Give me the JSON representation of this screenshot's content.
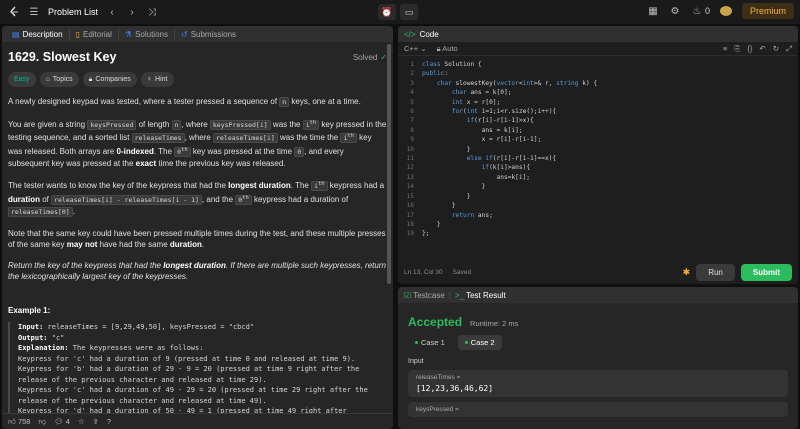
{
  "topbar": {
    "problem_list": "Problem List",
    "coins": "0",
    "premium": "Premium"
  },
  "left": {
    "tabs": [
      "Description",
      "Editorial",
      "Solutions",
      "Submissions"
    ],
    "title": "1629. Slowest Key",
    "solved": "Solved",
    "chips": [
      "Easy",
      "Topics",
      "Companies",
      "Hint"
    ],
    "p1": {
      "a": "A newly designed keypad was tested, where a tester pressed a sequence of ",
      "code": "n",
      "b": " keys, one at a time."
    },
    "p2": {
      "a": "You are given a string ",
      "c1": "keysPressed",
      "b": " of length ",
      "c2": "n",
      "c": ", where ",
      "c3": "keysPressed[i]",
      "d": " was the ",
      "ith": "i",
      "th": "th",
      "e": " key pressed in the testing sequence, and a sorted list ",
      "c4": "releaseTimes",
      "f": ", where ",
      "c5": "releaseTimes[i]",
      "g": " was the time the ",
      "h": " key was released. Both arrays are ",
      "bold1": "0-indexed",
      "i": ". The ",
      "zero": "0",
      "j": " key was pressed at the time ",
      "c6": "0",
      "k": ", and every subsequent key was pressed at the ",
      "bold2": "exact",
      "l": " time the previous key was released."
    },
    "p3": {
      "a": "The tester wants to know the key of the keypress that had the ",
      "bold1": "longest duration",
      "b": ". The ",
      "c": " keypress had a ",
      "bold2": "duration",
      "d": " of ",
      "c1": "releaseTimes[i] - releaseTimes[i - 1]",
      "e": ", and the ",
      "f": " keypress had a duration of ",
      "c2": "releaseTimes[0]",
      "g": "."
    },
    "p4": {
      "a": "Note that the same key could have been pressed multiple times during the test, and these multiple presses of the same key ",
      "bold1": "may not",
      "b": " have had the same ",
      "bold2": "duration",
      "c": "."
    },
    "p5": {
      "a": "Return the key of the keypress that had the ",
      "bold1": "longest duration",
      "b": ". If there are multiple such keypresses, return the lexicographically largest key of the keypresses."
    },
    "example_title": "Example 1:",
    "example": [
      {
        "label": "Input:",
        "text": " releaseTimes = [9,29,49,50], keysPressed = \"cbcd\""
      },
      {
        "label": "Output:",
        "text": " \"c\""
      },
      {
        "label": "Explanation:",
        "text": " The keypresses were as follows:"
      },
      {
        "label": "",
        "text": "Keypress for 'c' had a duration of 9 (pressed at time 0 and released at time 9)."
      },
      {
        "label": "",
        "text": "Keypress for 'b' had a duration of 29 - 9 = 20 (pressed at time 9 right after the release of the previous character and released at time 29)."
      },
      {
        "label": "",
        "text": "Keypress for 'c' had a duration of 49 - 29 = 20 (pressed at time 29 right after the release of the previous character and released at time 49)."
      },
      {
        "label": "",
        "text": "Keypress for 'd' had a duration of 50 - 49 = 1 (pressed at time 49 right after"
      }
    ],
    "likes": "758",
    "comments": "4"
  },
  "code": {
    "header": "Code",
    "lang": "C++",
    "auto": "Auto",
    "lines": [
      "class Solution {",
      "public:",
      "    char slowestKey(vector<int>& r, string k) {",
      "        char ans = k[0];",
      "        int x = r[0];",
      "        for(int i=1;i<r.size();i++){",
      "            if(r[i]-r[i-1]>x){",
      "                ans = k[i];",
      "                x = r[i]-r[i-1];",
      "            }",
      "            else if(r[i]-r[i-1]==x){",
      "                if(k[i]>ans){",
      "                    ans=k[i];",
      "                }",
      "            }",
      "        }",
      "        return ans;",
      "    }",
      "};"
    ],
    "status": "Ln 13, Col 30",
    "saved": "Saved",
    "run": "Run",
    "submit": "Submit"
  },
  "result": {
    "tabs": [
      "Testcase",
      "Test Result"
    ],
    "accepted": "Accepted",
    "runtime": "Runtime: 2 ms",
    "cases": [
      "Case 1",
      "Case 2"
    ],
    "input_label": "Input",
    "fields": [
      {
        "name": "releaseTimes =",
        "value": "[12,23,36,46,62]"
      },
      {
        "name": "keysPressed =",
        "value": ""
      }
    ]
  }
}
